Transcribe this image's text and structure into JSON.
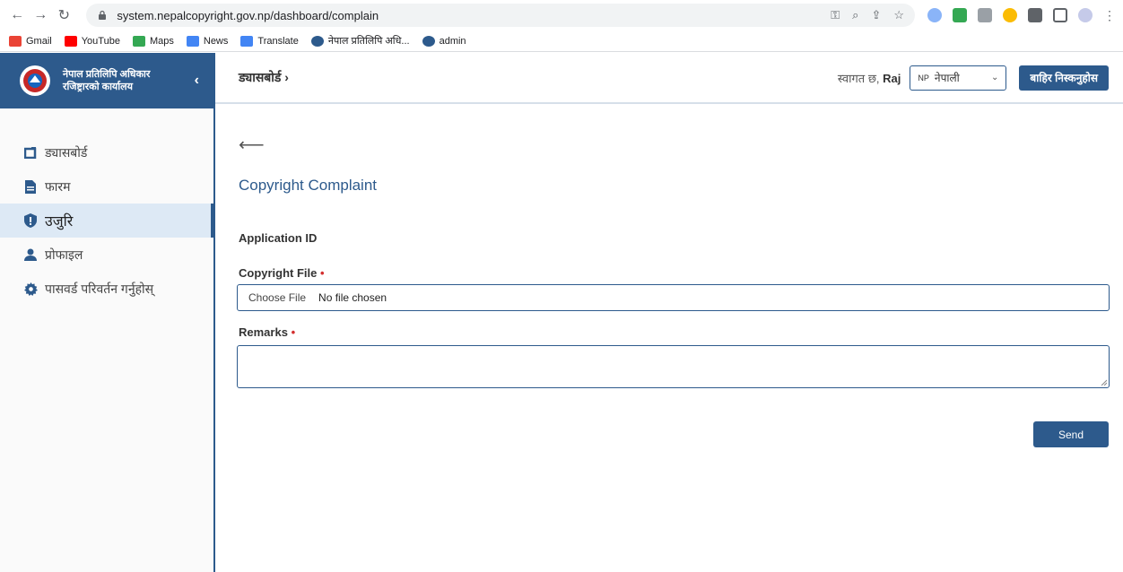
{
  "browser": {
    "url": "system.nepalcopyright.gov.np/dashboard/complain",
    "bookmarks": [
      {
        "label": "Gmail"
      },
      {
        "label": "YouTube"
      },
      {
        "label": "Maps"
      },
      {
        "label": "News"
      },
      {
        "label": "Translate"
      },
      {
        "label": "नेपाल प्रतिलिपि अधि..."
      },
      {
        "label": "admin"
      }
    ]
  },
  "sidebar": {
    "brand_line1": "नेपाल प्रतिलिपि अधिकार",
    "brand_line2": "रजिष्ट्रारको कार्यालय",
    "items": [
      {
        "label": "ड्यासबोर्ड",
        "icon": "dashboard-icon"
      },
      {
        "label": "फारम",
        "icon": "file-icon"
      },
      {
        "label": "उजुरि",
        "icon": "shield-icon",
        "active": true
      },
      {
        "label": "प्रोफाइल",
        "icon": "user-icon"
      },
      {
        "label": "पासवर्ड परिवर्तन गर्नुहोस्",
        "icon": "gear-icon"
      }
    ]
  },
  "header": {
    "breadcrumb": "ड्यासबोर्ड ›",
    "welcome": "स्वागत छ,",
    "user": "Raj",
    "lang_code": "NP",
    "lang_label": "नेपाली",
    "logout_label": "बाहिर निस्कनुहोस"
  },
  "form": {
    "title": "Copyright Complaint",
    "app_id_label": "Application ID",
    "file_label": "Copyright File",
    "required_mark": "•",
    "choose_file": "Choose File",
    "no_file": "No file chosen",
    "remarks_label": "Remarks",
    "remarks_value": "",
    "send_label": "Send"
  },
  "colors": {
    "primary": "#2d5a8c",
    "required": "#d32f2f"
  }
}
